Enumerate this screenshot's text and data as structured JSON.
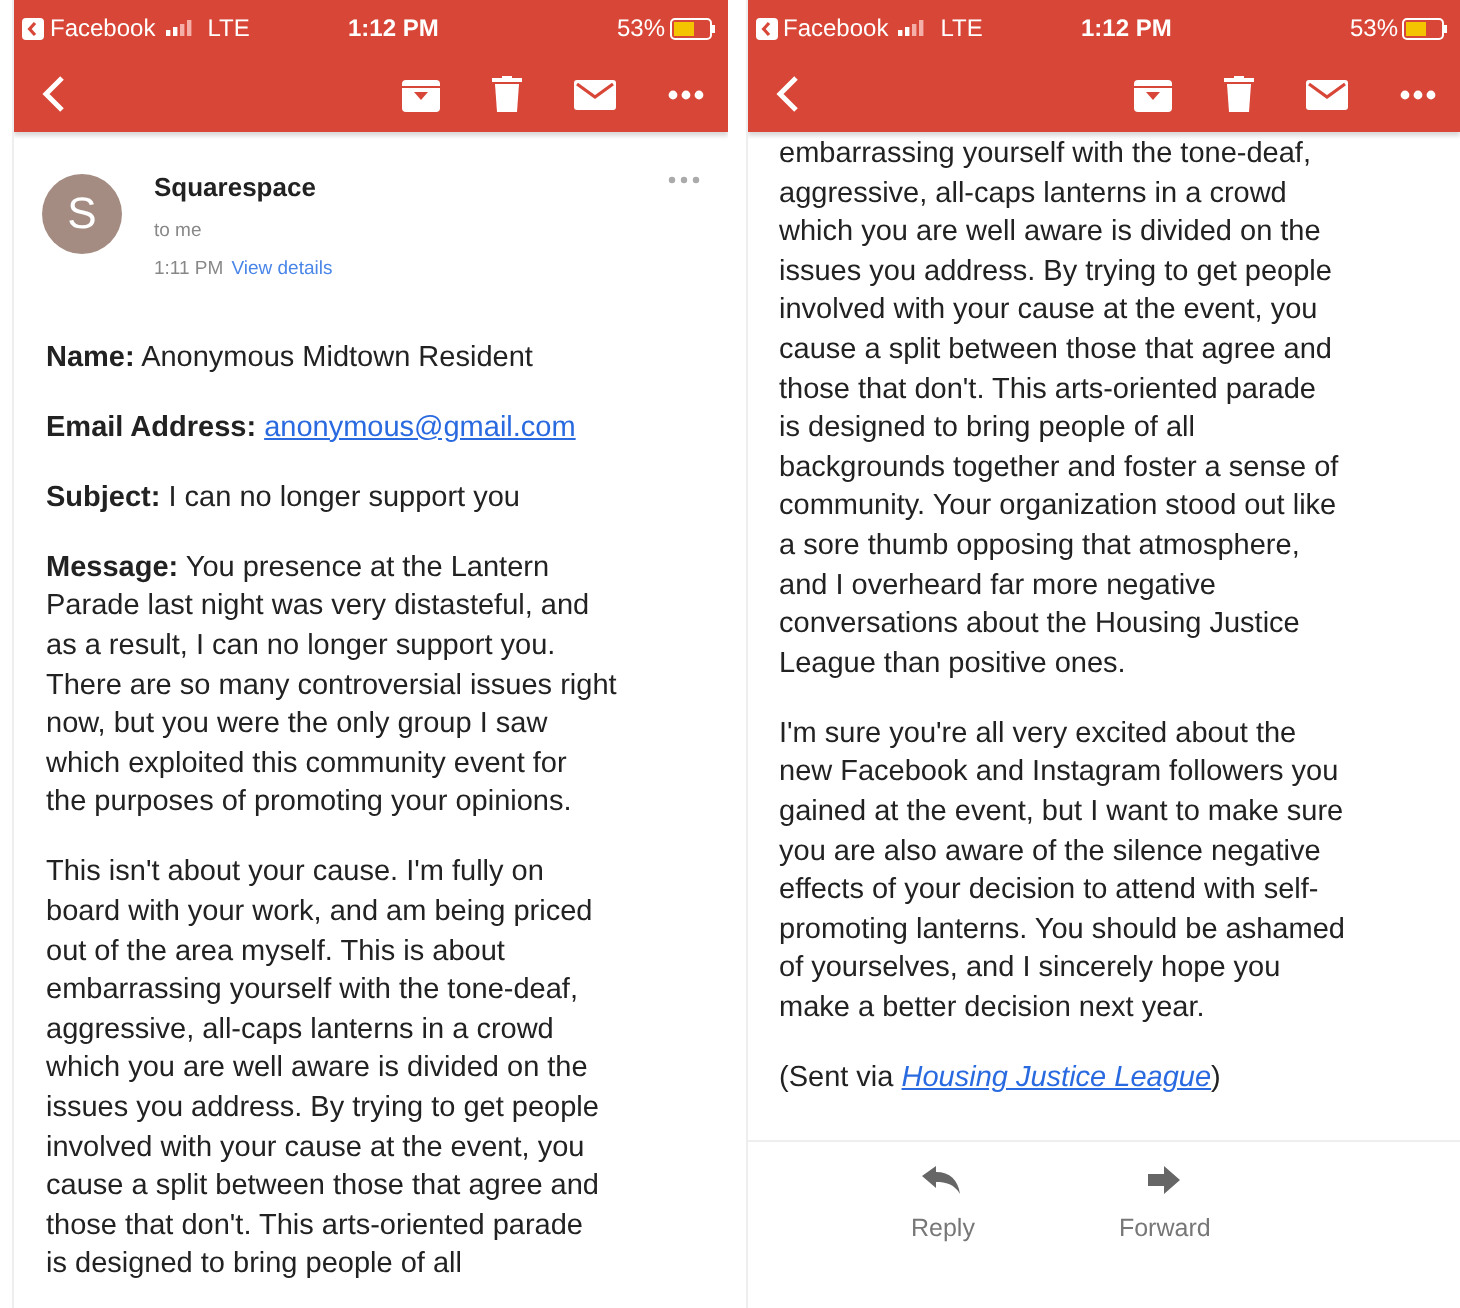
{
  "phones": [
    {
      "status_bar": {
        "app": "Facebook",
        "network": "LTE",
        "time": "1:12 PM",
        "battery": "53%"
      },
      "header": {
        "avatar_letter": "S",
        "sender": "Squarespace",
        "recipient": "to me",
        "time": "1:11 PM",
        "details_link": "View details"
      },
      "fields": [
        {
          "label": "Name:",
          "value": "Anonymous Midtown Resident",
          "kind": "text"
        },
        {
          "label": "Email Address:",
          "value": "anonymous@gmail.com",
          "kind": "link"
        },
        {
          "label": "Subject:",
          "value": "I can no longer support you",
          "kind": "text"
        }
      ],
      "paragraphs": [
        {
          "lines": [
            "**Message:** You presence at the Lantern",
            "Parade last night was very distasteful, and",
            "as a result, I can no longer support you.",
            "There are so many controversial issues right",
            "now, but you were the only group I saw",
            "which exploited this community event for",
            "the purposes of promoting your opinions."
          ]
        },
        {
          "lines": [
            "This isn't about your cause. I'm fully on",
            "board with your work, and am being priced",
            "out of the area myself. This is about",
            "embarrassing yourself with the tone-deaf,",
            "aggressive, all-caps lanterns in a crowd",
            "which you are well aware is divided on the",
            "issues you address. By trying to get people",
            "involved with your cause at the event, you",
            "cause a split between those that agree and",
            "those that don't. This arts-oriented parade",
            "is designed to bring people of all"
          ]
        }
      ]
    },
    {
      "status_bar": {
        "app": "Facebook",
        "network": "LTE",
        "time": "1:12 PM",
        "battery": "53%"
      },
      "paragraphs": [
        {
          "lines": [
            "embarrassing yourself with the tone-deaf,",
            "aggressive, all-caps lanterns in a crowd",
            "which you are well aware is divided on the",
            "issues you address. By trying to get people",
            "involved with your cause at the event, you",
            "cause a split between those that agree and",
            "those that don't. This arts-oriented parade",
            "is designed to bring people of all",
            "backgrounds together and foster a sense of",
            "community. Your organization stood out like",
            "a sore thumb opposing that atmosphere,",
            "and I overheard far more negative",
            "conversations about the Housing Justice",
            "League than positive ones."
          ]
        },
        {
          "lines": [
            "I'm sure you're all very excited about the",
            "new Facebook and Instagram followers you",
            "gained at the event, but I want to make sure",
            "you are also aware of the silence negative",
            "effects of your decision to attend with self-",
            "promoting lanterns. You should be ashamed",
            "of yourselves, and I sincerely hope you",
            "make a better decision next year."
          ]
        }
      ],
      "signature": {
        "prefix": "(Sent via",
        "link": "Housing Justice League",
        "suffix": ")"
      },
      "actions": [
        {
          "label": "Reply",
          "kind": "reply"
        },
        {
          "label": "Forward",
          "kind": "forward"
        }
      ]
    }
  ]
}
